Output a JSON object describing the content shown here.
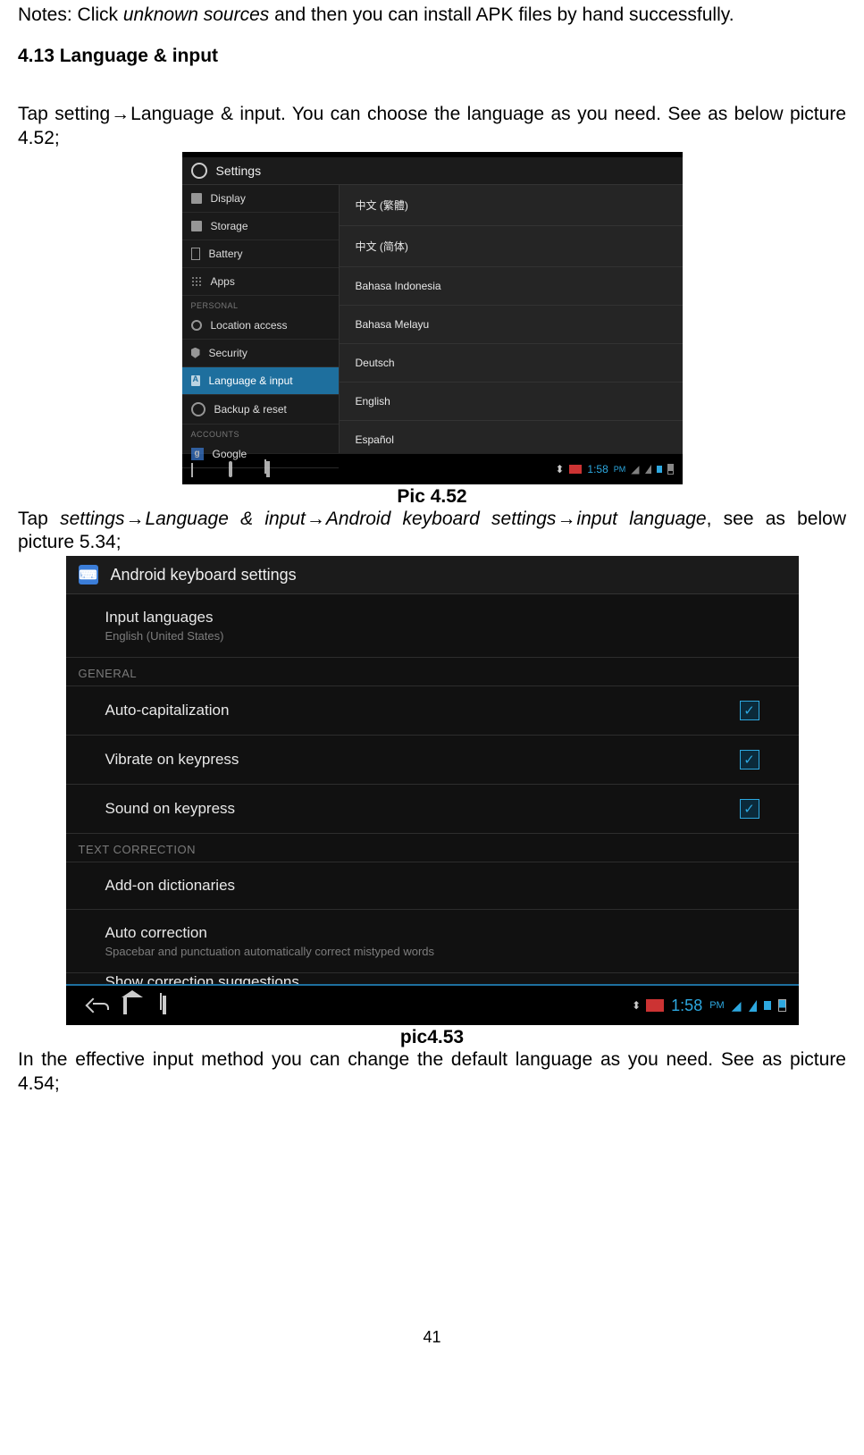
{
  "intro": {
    "notes_prefix": "Notes: Click ",
    "notes_italic": "unknown sources",
    "notes_suffix": " and then you can install APK files by hand successfully."
  },
  "section_heading": "4.13 Language & input",
  "para1": {
    "p1a": "Tap setting",
    "p1b": "Language & input. You can choose the language as you need. See as below picture 4.52;"
  },
  "caption1": "Pic 4.52",
  "para2": {
    "a": "Tap ",
    "b": "settings",
    "c": "Language & input",
    "d": "Android keyboard settings",
    "e": "input language",
    "f": ", see as below picture 5.34;"
  },
  "caption2": "pic4.53",
  "para3": "In the effective input method you can change the default language as you need. See as picture 4.54;",
  "page_number": "41",
  "arrow": "→",
  "shot1": {
    "title": "Settings",
    "sidebar": {
      "items": [
        {
          "label": "Display",
          "icon": "display"
        },
        {
          "label": "Storage",
          "icon": "storage"
        },
        {
          "label": "Battery",
          "icon": "battery"
        },
        {
          "label": "Apps",
          "icon": "apps"
        }
      ],
      "cat1": "PERSONAL",
      "items2": [
        {
          "label": "Location access",
          "icon": "loc"
        },
        {
          "label": "Security",
          "icon": "sec"
        },
        {
          "label": "Language & input",
          "icon": "lang",
          "selected": true
        },
        {
          "label": "Backup & reset",
          "icon": "backup"
        }
      ],
      "cat2": "ACCOUNTS",
      "items3": [
        {
          "label": "Google",
          "icon": "google",
          "glyph": "g"
        }
      ]
    },
    "languages": [
      "中文 (繁體)",
      "中文 (简体)",
      "Bahasa Indonesia",
      "Bahasa Melayu",
      "Deutsch",
      "English",
      "Español"
    ],
    "clock": "1:58",
    "pm": "PM"
  },
  "shot2": {
    "title": "Android keyboard settings",
    "input_languages": {
      "label": "Input languages",
      "sub": "English (United States)"
    },
    "cat_general": "GENERAL",
    "rows_general": [
      {
        "label": "Auto-capitalization",
        "checked": true
      },
      {
        "label": "Vibrate on keypress",
        "checked": true
      },
      {
        "label": "Sound on keypress",
        "checked": true
      }
    ],
    "cat_text": "TEXT CORRECTION",
    "rows_text": [
      {
        "label": "Add-on dictionaries"
      },
      {
        "label": "Auto correction",
        "sub": "Spacebar and punctuation automatically correct mistyped words"
      }
    ],
    "cutoff": "Show correction suggestions",
    "clock": "1:58",
    "pm": "PM"
  }
}
